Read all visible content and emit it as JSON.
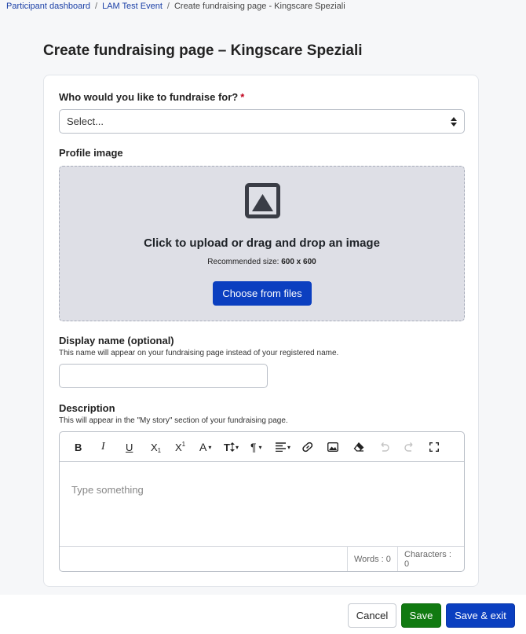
{
  "breadcrumb": {
    "items": [
      "Participant dashboard",
      "LAM Test Event"
    ],
    "separator": "/",
    "current": "Create fundraising page - Kingscare Speziali"
  },
  "page_title": "Create fundraising page – Kingscare Speziali",
  "fundraise_for": {
    "label": "Who would you like to fundraise for?",
    "required_mark": "*",
    "selected": "Select..."
  },
  "profile_image": {
    "label": "Profile image",
    "title": "Click to upload or drag and drop an image",
    "recommended_prefix": "Recommended size:",
    "recommended_size": "600 x 600",
    "choose_button": "Choose from files",
    "icon": "image-icon"
  },
  "display_name": {
    "label": "Display name (optional)",
    "hint": "This name will appear on your fundraising page instead of your registered name.",
    "value": ""
  },
  "description": {
    "label": "Description",
    "hint": "This will appear in the \"My story\" section of your fundraising page.",
    "placeholder": "Type something",
    "toolbar": {
      "bold": "B",
      "italic": "I",
      "underline": "U",
      "subscript_base": "X",
      "subscript_mark": "1",
      "superscript_base": "X",
      "superscript_mark": "1",
      "font_color": "A",
      "font_size": "T",
      "paragraph": "¶",
      "dropdown_caret": "▾"
    },
    "words_label": "Words : 0",
    "characters_label": "Characters : 0"
  },
  "actions": {
    "cancel": "Cancel",
    "save": "Save",
    "save_exit": "Save & exit"
  },
  "colors": {
    "primary": "#0b3fc0",
    "success": "#117a11",
    "required": "#c0001b"
  }
}
